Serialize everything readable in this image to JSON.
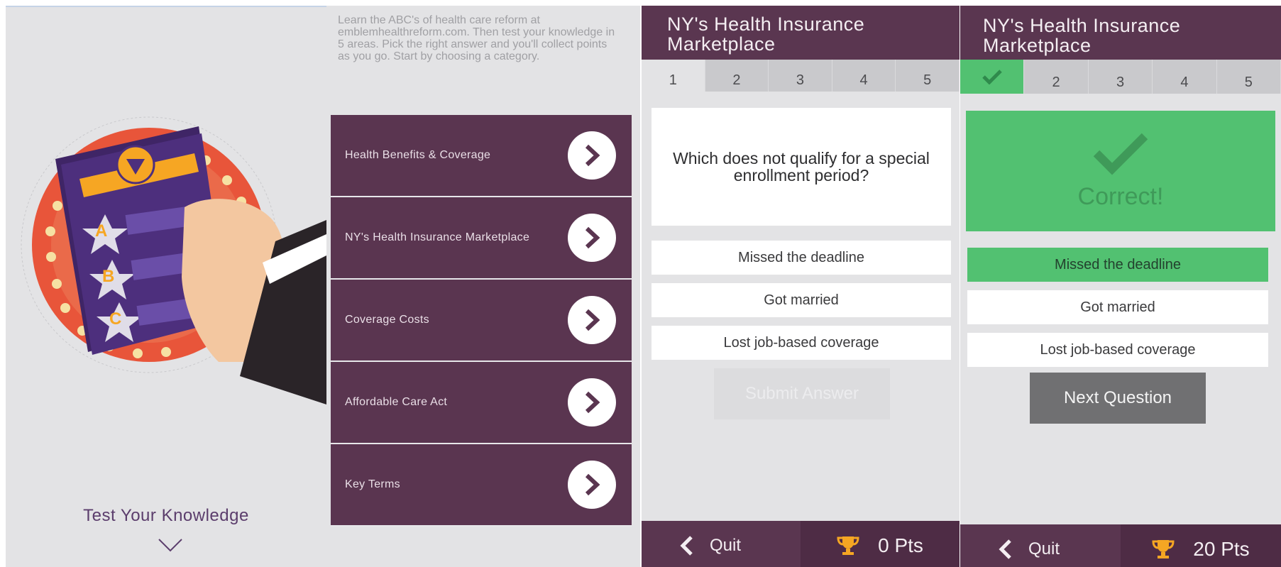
{
  "screen1": {
    "title": "Test Your Knowledge",
    "illustration_letters": [
      "A",
      "B",
      "C"
    ],
    "icons": [
      "chevron-down-icon"
    ]
  },
  "screen2": {
    "intro": "Learn the ABC's of health care reform at emblemhealthreform.com. Then test your knowledge in 5 areas. Pick the right answer and you'll collect points as you go. Start by choosing a category.",
    "categories": [
      {
        "label": "Health Benefits & Coverage"
      },
      {
        "label": "NY's Health Insurance Marketplace"
      },
      {
        "label": "Coverage Costs"
      },
      {
        "label": "Affordable Care Act"
      },
      {
        "label": "Key Terms"
      }
    ]
  },
  "screen3": {
    "header_line1": "NY's Health Insurance",
    "header_line2": "Marketplace",
    "tabs": [
      "1",
      "2",
      "3",
      "4",
      "5"
    ],
    "question": "Which does not qualify for a special enrollment period?",
    "answers": [
      "Missed the deadline",
      "Got married",
      "Lost job-based coverage"
    ],
    "submit_label": "Submit Answer",
    "quit_label": "Quit",
    "points": "0 Pts"
  },
  "screen4": {
    "header_line1": "NY's Health Insurance",
    "header_line2": "Marketplace",
    "tabs": [
      "2",
      "3",
      "4",
      "5"
    ],
    "result": "Correct!",
    "answers": [
      "Missed the deadline",
      "Got married",
      "Lost job-based coverage"
    ],
    "next_label": "Next Question",
    "quit_label": "Quit",
    "points": "20 Pts"
  },
  "colors": {
    "purple": "#5a3650",
    "green": "#52c171",
    "background": "#e3e3e5",
    "orange": "#f5a623"
  }
}
